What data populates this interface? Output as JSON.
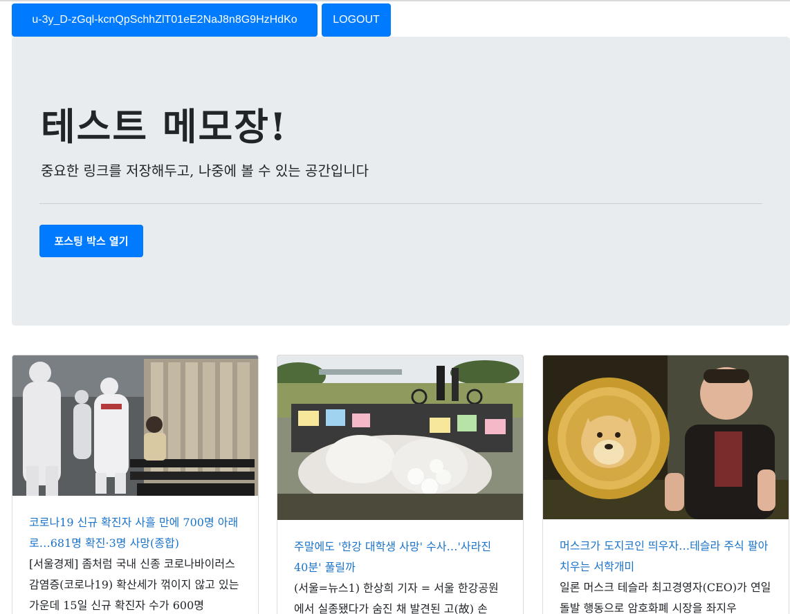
{
  "header": {
    "user_button_label": "u-3y_D-zGql-kcnQpSchhZlT01eE2NaJ8n8G9HzHdKo",
    "logout_label": "LOGOUT"
  },
  "jumbotron": {
    "title": "테스트 메모장!",
    "lead": "중요한 링크를 저장해두고, 나중에 볼 수 있는 공간입니다",
    "posting_button_label": "포스팅 박스 열기"
  },
  "cards": [
    {
      "image_desc": "photo",
      "title": "코로나19 신규 확진자 사흘 만에 700명 아래로…681명 확진·3명 사망(종합)",
      "text": "[서울경제] 좀처럼 국내 신종 코로나바이러스 감염증(코로나19) 확산세가 꺾이지 않고 있는 가운데 15일 신규 확진자 수가 600명"
    },
    {
      "image_desc": "photo",
      "title": "주말에도 '한강 대학생 사망' 수사…'사라진 40분' 풀릴까",
      "text": "(서울=뉴스1) 한상희 기자 = 서울 한강공원에서 실종됐다가 숨진 채 발견된 고(故) 손"
    },
    {
      "image_desc": "photo",
      "title": "머스크가 도지코인 띄우자…테슬라 주식 팔아치우는 서학개미",
      "text": "일론 머스크 테슬라 최고경영자(CEO)가 연일 돌발 행동으로 암호화폐 시장을 좌지우"
    }
  ],
  "colors": {
    "primary": "#007bff",
    "jumbotron_bg": "#e9ecef",
    "link": "#1a73c9"
  }
}
